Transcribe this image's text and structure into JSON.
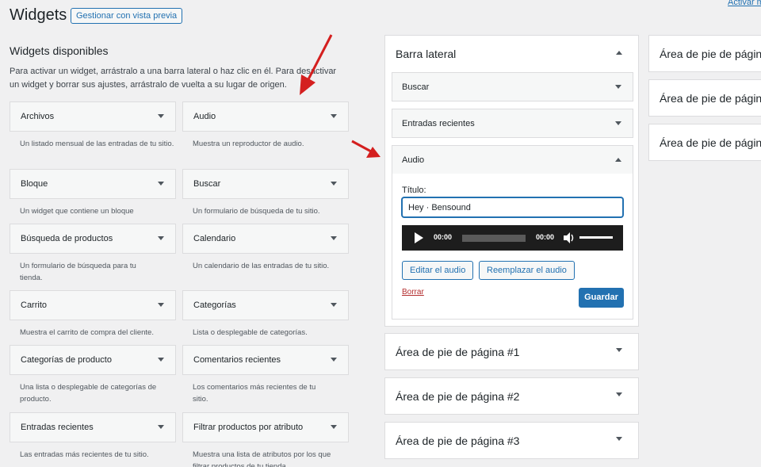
{
  "header": {
    "title": "Widgets",
    "preview_button": "Gestionar con vista previa",
    "top_link": "Activar m"
  },
  "available": {
    "title": "Widgets disponibles",
    "intro": "Para activar un widget, arrástralo a una barra lateral o haz clic en él. Para desactivar un widget y borrar sus ajustes, arrástralo de vuelta a su lugar de origen.",
    "widgets": [
      {
        "name": "Archivos",
        "desc": "Un listado mensual de las entradas de tu sitio."
      },
      {
        "name": "Audio",
        "desc": "Muestra un reproductor de audio."
      },
      {
        "name": "Bloque",
        "desc": "Un widget que contiene un bloque"
      },
      {
        "name": "Buscar",
        "desc": "Un formulario de búsqueda de tu sitio."
      },
      {
        "name": "Búsqueda de productos",
        "desc": "Un formulario de búsqueda para tu tienda."
      },
      {
        "name": "Calendario",
        "desc": "Un calendario de las entradas de tu sitio."
      },
      {
        "name": "Carrito",
        "desc": "Muestra el carrito de compra del cliente."
      },
      {
        "name": "Categorías",
        "desc": "Lista o desplegable de categorías."
      },
      {
        "name": "Categorías de producto",
        "desc": "Una lista o desplegable de categorías de producto."
      },
      {
        "name": "Comentarios recientes",
        "desc": "Los comentarios más recientes de tu sitio."
      },
      {
        "name": "Entradas recientes",
        "desc": "Las entradas más recientes de tu sitio."
      },
      {
        "name": "Filtrar productos por atributo",
        "desc": "Muestra una lista de atributos por los que filtrar productos de tu tienda."
      }
    ]
  },
  "sidebar": {
    "title": "Barra lateral",
    "widgets": [
      {
        "name": "Buscar"
      },
      {
        "name": "Entradas recientes"
      }
    ],
    "audio_widget": {
      "name": "Audio",
      "title_label": "Título:",
      "title_value": "Hey · Bensound",
      "time_current": "00:00",
      "time_total": "00:00",
      "edit_button": "Editar el audio",
      "replace_button": "Reemplazar el audio",
      "delete_link": "Borrar",
      "save_button": "Guardar"
    }
  },
  "footer_areas": [
    {
      "title": "Área de pie de página #1"
    },
    {
      "title": "Área de pie de página #2"
    },
    {
      "title": "Área de pie de página #3"
    }
  ],
  "right_areas": [
    {
      "title": "Área de pie de página"
    },
    {
      "title": "Área de pie de página"
    },
    {
      "title": "Área de pie de página"
    }
  ],
  "colors": {
    "accent": "#2271b1",
    "annotation_arrow": "#d41f1f",
    "delete": "#b32d2e"
  }
}
